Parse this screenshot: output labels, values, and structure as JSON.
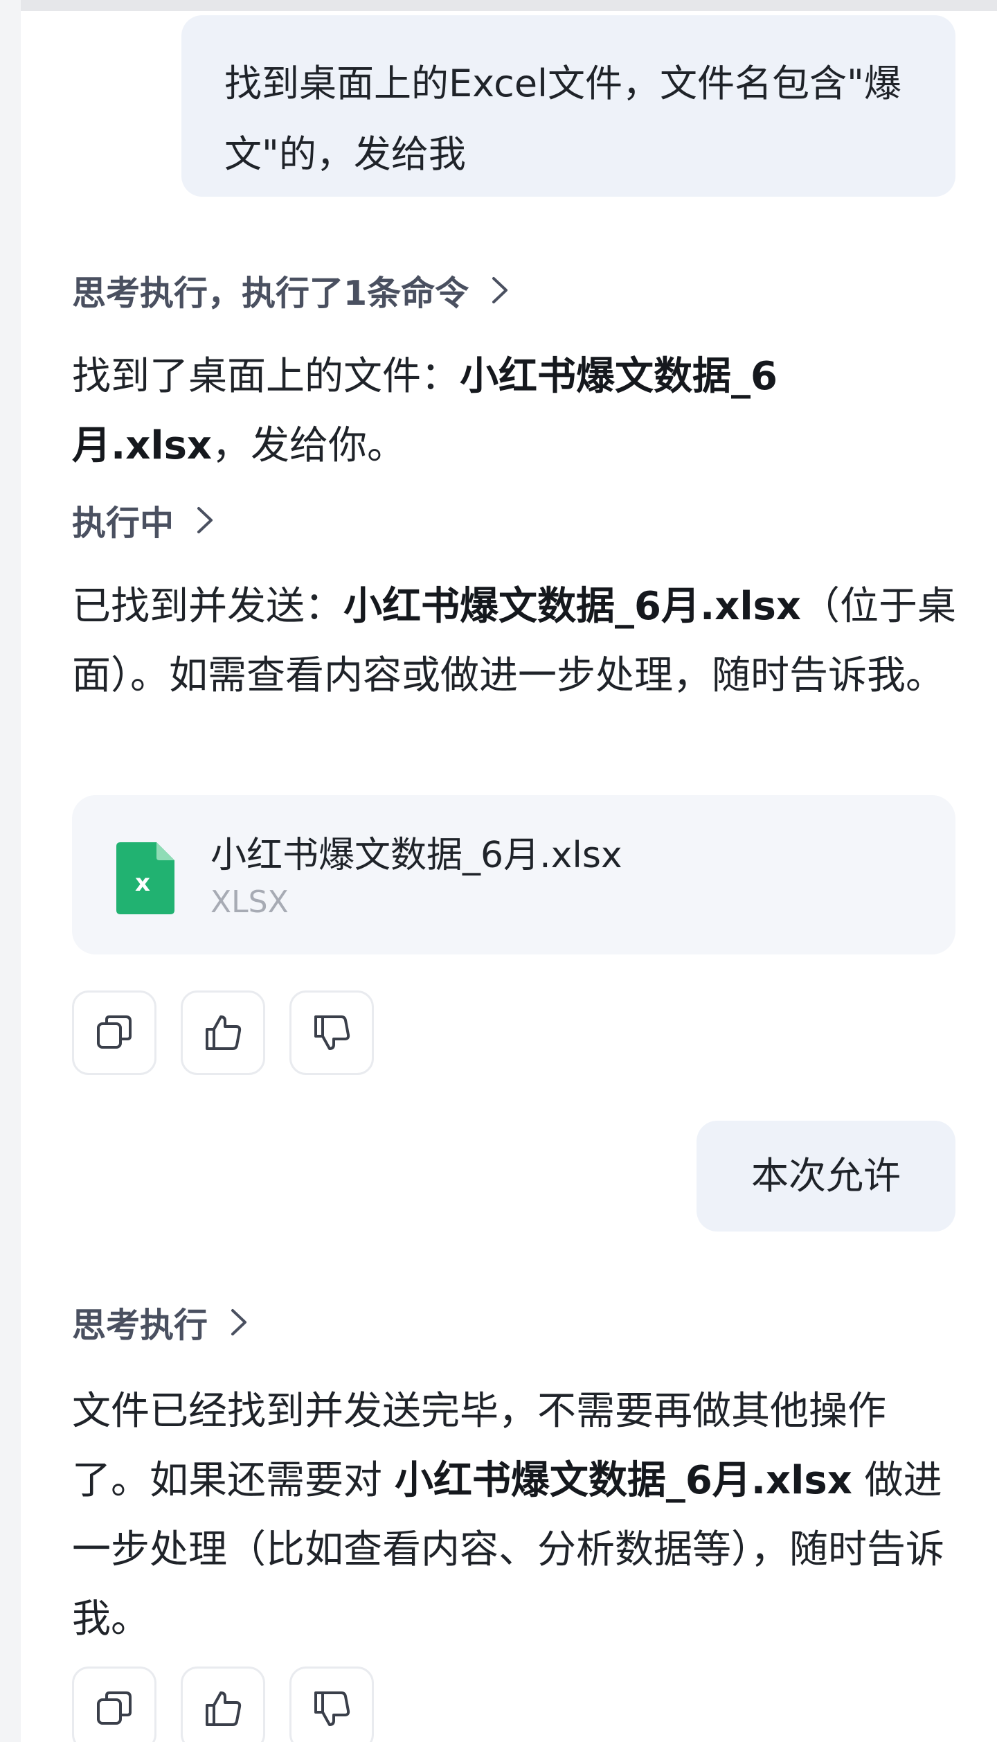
{
  "messages": {
    "user_1": "找到桌面上的Excel文件，文件名包含\"爆文\"的，发给我",
    "step_1": "思考执行，执行了1条命令",
    "answer_1_prefix": "找到了桌面上的文件：",
    "answer_1_file": "小红书爆文数据_6月.xlsx",
    "answer_1_suffix": "，发给你。",
    "step_2": "执行中",
    "answer_2_prefix": "已找到并发送：",
    "answer_2_file": "小红书爆文数据_6月.xlsx",
    "answer_2_suffix": "（位于桌面）。如需查看内容或做进一步处理，随时告诉我。",
    "file_card": {
      "name": "小红书爆文数据_6月.xlsx",
      "type": "XLSX",
      "icon": "excel-file-icon",
      "icon_color": "#21b271"
    },
    "user_2": "本次允许",
    "step_3": "思考执行",
    "answer_3_prefix": "文件已经找到并发送完毕，不需要再做其他操作了。如果还需要对 ",
    "answer_3_file": "小红书爆文数据_6月.xlsx",
    "answer_3_suffix": " 做进一步处理（比如查看内容、分析数据等），随时告诉我。"
  },
  "actions": [
    "copy-icon",
    "thumbs-up-icon",
    "thumbs-down-icon"
  ],
  "colors": {
    "user_bubble_bg": "#eef2f9",
    "file_card_bg": "#f4f6fa",
    "step_text": "#4a5060"
  }
}
